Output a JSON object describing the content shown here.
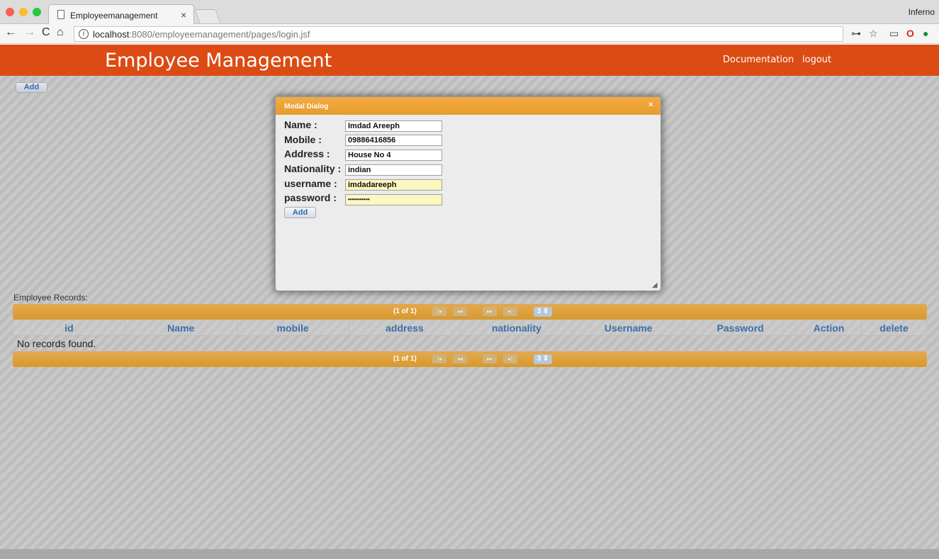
{
  "browser": {
    "tab_title": "Employeemanagement",
    "tab_close": "×",
    "profile_name": "Inferno",
    "url_host": "localhost",
    "url_path": ":8080/employeemanagement/pages/login.jsf",
    "nav": {
      "back": "←",
      "forward": "→",
      "reload": "C",
      "home": "⌂"
    },
    "toolbar_icons": {
      "key": "⊶",
      "star": "☆",
      "cast": "▭",
      "opera": "O",
      "ext": "●"
    },
    "traffic_colors": [
      "#fc5f57",
      "#fdbc2e",
      "#28c840"
    ]
  },
  "header": {
    "title": "Employee Management",
    "links": [
      "Documentation",
      "logout"
    ],
    "color": "#db4b13"
  },
  "page": {
    "add_label": "Add",
    "records_label": "Employee Records:"
  },
  "pager": {
    "count": "(1 of 1)",
    "first": "|◂",
    "prev": "◂◂",
    "next": "▸▸",
    "last": "▸|",
    "rows_per_page": "3 ⇕"
  },
  "table": {
    "columns": [
      "id",
      "Name",
      "mobile",
      "address",
      "nationality",
      "Username",
      "Password",
      "Action",
      "delete"
    ],
    "empty_message": "No records found."
  },
  "modal": {
    "title": "Modal Dialog",
    "close": "×",
    "resize": "◢",
    "fields": [
      {
        "label": "Name :",
        "value": "Imdad Areeph"
      },
      {
        "label": "Mobile :",
        "value": "09886416856"
      },
      {
        "label": "Address :",
        "value": "House No 4"
      },
      {
        "label": "Nationality :",
        "value": "indian"
      },
      {
        "label": "username :",
        "value": "imdadareeph"
      },
      {
        "label": "password :",
        "value": "•••••••••••"
      }
    ],
    "add_label": "Add"
  }
}
